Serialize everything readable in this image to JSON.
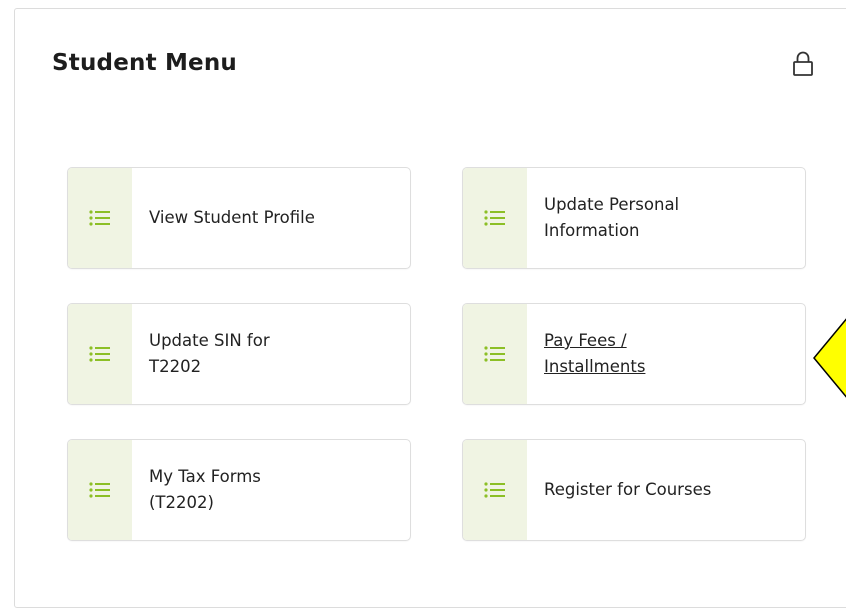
{
  "menu": {
    "title": "Student Menu",
    "lock_icon": "lock-icon",
    "accent_color": "#8cbf26",
    "strip_color": "#f0f4e3",
    "items": [
      {
        "line1": "View Student Profile",
        "line2": "",
        "icon": "list-icon",
        "link": false
      },
      {
        "line1": "Update Personal",
        "line2": "Information",
        "icon": "list-icon",
        "link": false
      },
      {
        "line1": "Update SIN for",
        "line2": "T2202",
        "icon": "list-icon",
        "link": false
      },
      {
        "line1": "Pay Fees /",
        "line2": "Installments",
        "icon": "list-icon",
        "link": true
      },
      {
        "line1": "My Tax Forms",
        "line2": "(T2202)",
        "icon": "list-icon",
        "link": false
      },
      {
        "line1": "Register for Courses",
        "line2": "",
        "icon": "list-icon",
        "link": false
      }
    ]
  },
  "callout": {
    "color": "#ffff00",
    "icon": "yellow-arrow-pointer"
  }
}
